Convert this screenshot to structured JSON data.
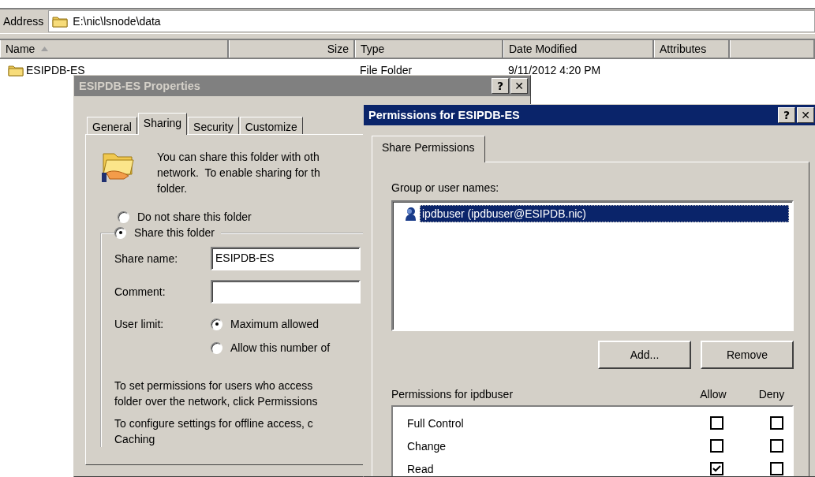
{
  "explorer": {
    "address_label": "Address",
    "address": "E:\\nic\\lsnode\\data",
    "columns": [
      {
        "label": "Name",
        "sorted": true
      },
      {
        "label": "Size",
        "sorted": false
      },
      {
        "label": "Type",
        "sorted": false
      },
      {
        "label": "Date Modified",
        "sorted": false
      },
      {
        "label": "Attributes",
        "sorted": false
      }
    ],
    "rows": [
      {
        "name": "ESIPDB-ES",
        "type": "File Folder",
        "date_modified": "9/11/2012 4:20 PM"
      }
    ]
  },
  "properties_dialog": {
    "title": "ESIPDB-ES Properties",
    "active": false,
    "title_buttons": [
      "?",
      "✕"
    ],
    "tabs": [
      {
        "label": "General",
        "selected": false
      },
      {
        "label": "Sharing",
        "selected": true
      },
      {
        "label": "Security",
        "selected": false
      },
      {
        "label": "Customize",
        "selected": false
      }
    ],
    "intro": "You can share this folder with oth\nnetwork.  To enable sharing for th\nfolder.",
    "sharing_options": [
      {
        "label": "Do not share this folder",
        "selected": false
      },
      {
        "label": "Share this folder",
        "selected": true
      }
    ],
    "share_name_label": "Share name:",
    "share_name": "ESIPDB-ES",
    "comment_label": "Comment:",
    "user_limit_label": "User limit:",
    "user_limit_options": [
      {
        "label": "Maximum allowed",
        "selected": true
      },
      {
        "label": "Allow this number of",
        "selected": false
      }
    ],
    "permissions_note": "To set permissions for users who access\nfolder over the network, click Permissions",
    "offline_note": "To configure settings for offline access, c\nCaching"
  },
  "permissions_dialog": {
    "title": "Permissions for ESIPDB-ES",
    "active": true,
    "title_buttons": [
      "?",
      "✕"
    ],
    "tabs": [
      {
        "label": "Share Permissions",
        "selected": true
      }
    ],
    "users_label": "Group or user names:",
    "users": [
      {
        "name": "ipdbuser (ipdbuser@ESIPDB.nic)",
        "selected": true
      }
    ],
    "buttons": [
      "Add...",
      "Remove"
    ],
    "permissions_label": "Permissions for ipdbuser",
    "columns": [
      "Allow",
      "Deny"
    ],
    "permissions": [
      {
        "name": "Full Control",
        "allow": false,
        "deny": false
      },
      {
        "name": "Change",
        "allow": false,
        "deny": false
      },
      {
        "name": "Read",
        "allow": true,
        "deny": false
      }
    ]
  }
}
